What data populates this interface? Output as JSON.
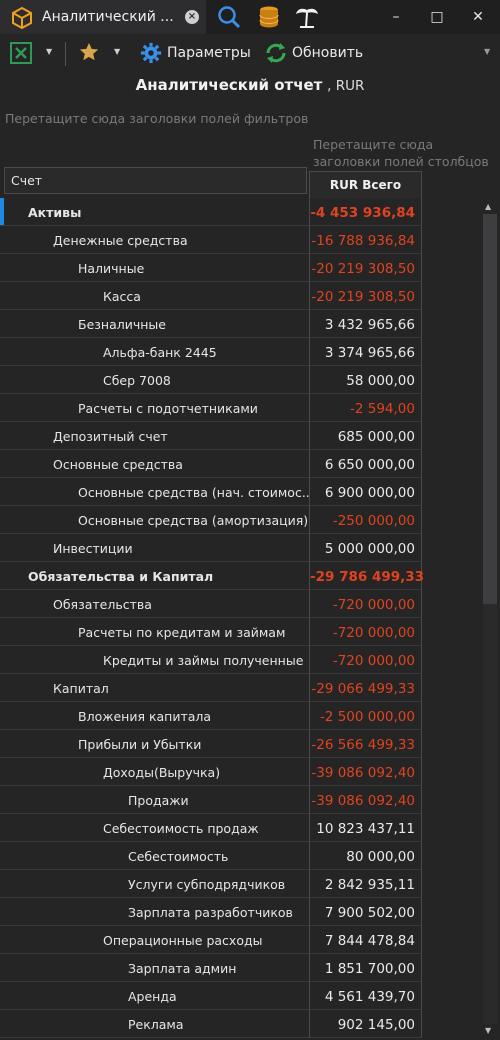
{
  "tab": {
    "title": "Аналитический ..."
  },
  "toolbar": {
    "params_label": "Параметры",
    "refresh_label": "Обновить"
  },
  "header": {
    "title": "Аналитический отчет",
    "currency": ", RUR"
  },
  "hints": {
    "filter": "Перетащите сюда заголовки полей фильтров",
    "columns": "Перетащите сюда заголовки полей столбцов"
  },
  "grid": {
    "row_header": "Счет",
    "column_header": "RUR Всего",
    "rows": [
      {
        "label": "Активы",
        "value": "-4 453 936,84",
        "level": 0,
        "bold": true,
        "neg": true,
        "selected": true
      },
      {
        "label": "Денежные средства",
        "value": "-16 788 936,84",
        "level": 1,
        "neg": true
      },
      {
        "label": "Наличные",
        "value": "-20 219 308,50",
        "level": 2,
        "neg": true
      },
      {
        "label": "Касса",
        "value": "-20 219 308,50",
        "level": 3,
        "neg": true
      },
      {
        "label": "Безналичные",
        "value": "3 432 965,66",
        "level": 2
      },
      {
        "label": "Альфа-банк 2445",
        "value": "3 374 965,66",
        "level": 3
      },
      {
        "label": "Сбер 7008",
        "value": "58 000,00",
        "level": 3
      },
      {
        "label": "Расчеты с подотчетниками",
        "value": "-2 594,00",
        "level": 2,
        "neg": true
      },
      {
        "label": "Депозитный счет",
        "value": "685 000,00",
        "level": 1
      },
      {
        "label": "Основные средства",
        "value": "6 650 000,00",
        "level": 1
      },
      {
        "label": "Основные средства (нач. стоимос...",
        "value": "6 900 000,00",
        "level": 2
      },
      {
        "label": "Основные средства (амортизация)",
        "value": "-250 000,00",
        "level": 2,
        "neg": true
      },
      {
        "label": "Инвестиции",
        "value": "5 000 000,00",
        "level": 1
      },
      {
        "label": "Обязательства и Капитал",
        "value": "-29 786 499,33",
        "level": -1,
        "bold": true,
        "neg": true
      },
      {
        "label": "Обязательства",
        "value": "-720 000,00",
        "level": 1,
        "neg": true
      },
      {
        "label": "Расчеты по кредитам и займам",
        "value": "-720 000,00",
        "level": 2,
        "neg": true
      },
      {
        "label": "Кредиты и займы полученные",
        "value": "-720 000,00",
        "level": 3,
        "neg": true
      },
      {
        "label": "Капитал",
        "value": "-29 066 499,33",
        "level": 1,
        "neg": true
      },
      {
        "label": "Вложения капитала",
        "value": "-2 500 000,00",
        "level": 2,
        "neg": true
      },
      {
        "label": "Прибыли и Убытки",
        "value": "-26 566 499,33",
        "level": 2,
        "neg": true
      },
      {
        "label": "Доходы(Выручка)",
        "value": "-39 086 092,40",
        "level": 3,
        "neg": true
      },
      {
        "label": "Продажи",
        "value": "-39 086 092,40",
        "level": 4,
        "neg": true
      },
      {
        "label": "Себестоимость продаж",
        "value": "10 823 437,11",
        "level": 3
      },
      {
        "label": "Себестоимость",
        "value": "80 000,00",
        "level": 4
      },
      {
        "label": "Услуги субподрядчиков",
        "value": "2 842 935,11",
        "level": 4
      },
      {
        "label": "Зарплата разработчиков",
        "value": "7 900 502,00",
        "level": 4
      },
      {
        "label": "Операционные расходы",
        "value": "7 844 478,84",
        "level": 3
      },
      {
        "label": "Зарплата админ",
        "value": "1 851 700,00",
        "level": 4
      },
      {
        "label": "Аренда",
        "value": "4 561 439,70",
        "level": 4
      },
      {
        "label": "Реклама",
        "value": "902 145,00",
        "level": 4
      }
    ]
  },
  "colors": {
    "negative": "#e0431f",
    "accent": "#1e88e5",
    "background": "#252526"
  },
  "icons": [
    "cube-icon",
    "close-icon",
    "search-icon",
    "database-icon",
    "palm-icon",
    "excel-icon",
    "star-icon",
    "gear-icon",
    "refresh-icon"
  ]
}
